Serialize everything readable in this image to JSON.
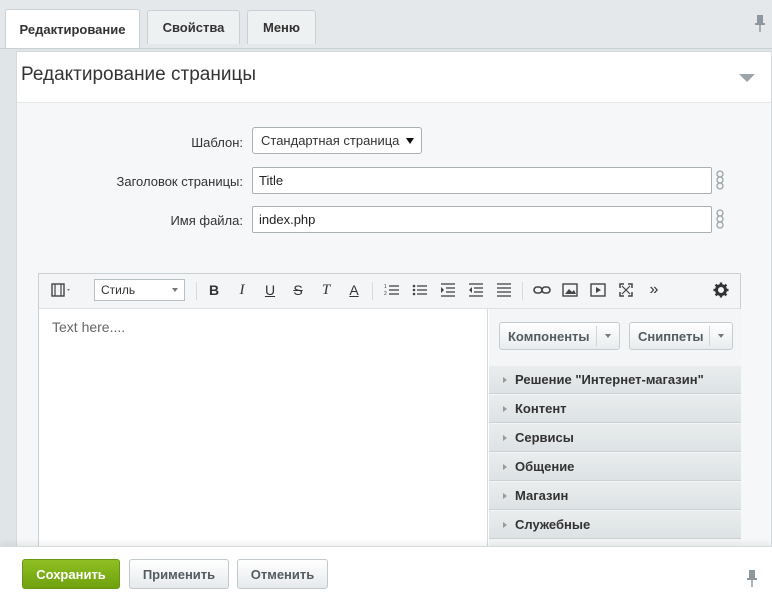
{
  "tabs": [
    {
      "label": "Редактирование",
      "active": true
    },
    {
      "label": "Свойства",
      "active": false
    },
    {
      "label": "Меню",
      "active": false
    }
  ],
  "panel": {
    "title": "Редактирование страницы"
  },
  "form": {
    "template_label": "Шаблон:",
    "template_value": "Стандартная страница",
    "page_title_label": "Заголовок страницы:",
    "page_title_value": "Title",
    "filename_label": "Имя файла:",
    "filename_value": "index.php"
  },
  "editor": {
    "style_select": "Стиль",
    "placeholder": "Text here....",
    "toolbar_icons": [
      "view-mode-icon",
      "bold-icon",
      "italic-icon",
      "underline-icon",
      "strikethrough-icon",
      "remove-format-icon",
      "font-color-icon",
      "ordered-list-icon",
      "unordered-list-icon",
      "indent-icon",
      "outdent-icon",
      "align-icon",
      "link-icon",
      "image-icon",
      "video-icon",
      "fullscreen-icon",
      "more-icon",
      "settings-icon"
    ],
    "toolbar_text": {
      "bold": "B",
      "italic": "I",
      "underline": "U",
      "strike": "S",
      "remove_format": "T",
      "font_color": "A",
      "more": "»"
    }
  },
  "sidebar": {
    "components_label": "Компоненты",
    "snippets_label": "Сниппеты",
    "categories": [
      "Решение \"Интернет-магазин\"",
      "Контент",
      "Сервисы",
      "Общение",
      "Магазин",
      "Служебные"
    ]
  },
  "buttons": {
    "save": "Сохранить",
    "apply": "Применить",
    "cancel": "Отменить"
  },
  "colors": {
    "primary_button": "#7cae17",
    "background": "#e0e5e7",
    "panel_body": "#f5f7f8"
  }
}
